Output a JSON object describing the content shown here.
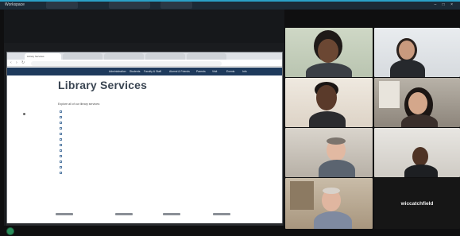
{
  "meeting": {
    "title": "Workspace",
    "os_tabs": [
      "",
      "",
      ""
    ],
    "window_controls": "– □ ×"
  },
  "browser": {
    "tabs": [
      "Library Services",
      "",
      "",
      "",
      ""
    ],
    "address": "",
    "nav_items": [
      "Administration",
      "Students",
      "Faculty & Staff",
      "Alumni & Friends",
      "Parents",
      "Visit",
      "Events",
      "Info"
    ]
  },
  "page": {
    "title": "Library Services",
    "intro": "Explore all of our library services:",
    "services": [
      "",
      "",
      "",
      "",
      "",
      "",
      "",
      "",
      "",
      "",
      "",
      ""
    ],
    "footer_lines": [
      "",
      ""
    ]
  },
  "participants": [
    {
      "name": "",
      "speaking": true
    },
    {
      "name": "",
      "speaking": false
    },
    {
      "name": "",
      "speaking": false
    },
    {
      "name": "",
      "speaking": false
    },
    {
      "name": "",
      "speaking": false
    },
    {
      "name": "",
      "speaking": false
    },
    {
      "name": "",
      "speaking": false
    },
    {
      "name": "wiccatchfield",
      "speaking": false
    }
  ]
}
